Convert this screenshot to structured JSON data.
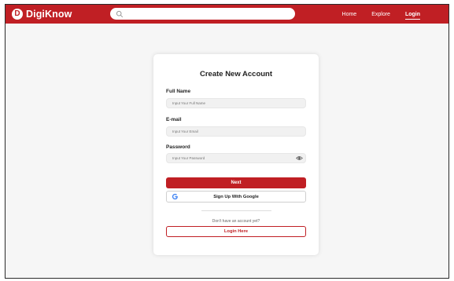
{
  "brand": {
    "logo_letter": "D",
    "name": "DigiKnow"
  },
  "search": {
    "placeholder": "",
    "icon": "search-icon"
  },
  "nav": {
    "home": "Home",
    "explore": "Explore",
    "login": "Login",
    "active": "Login"
  },
  "form": {
    "title": "Create New Account",
    "full_name": {
      "label": "Full Name",
      "placeholder": "Input Your Full Name",
      "value": ""
    },
    "email": {
      "label": "E-mail",
      "placeholder": "Input Your Email",
      "value": ""
    },
    "password": {
      "label": "Password",
      "placeholder": "Input Your Password",
      "value": "",
      "toggle_icon": "eye-icon"
    },
    "next_label": "Next",
    "google_label": "Sign Up With Google",
    "google_icon": "google-icon",
    "no_account_text": "Don't have an account yet?",
    "login_here_label": "Login Here"
  },
  "colors": {
    "brand_red": "#c01f24",
    "page_bg": "#f6f6f6",
    "card_bg": "#ffffff"
  }
}
